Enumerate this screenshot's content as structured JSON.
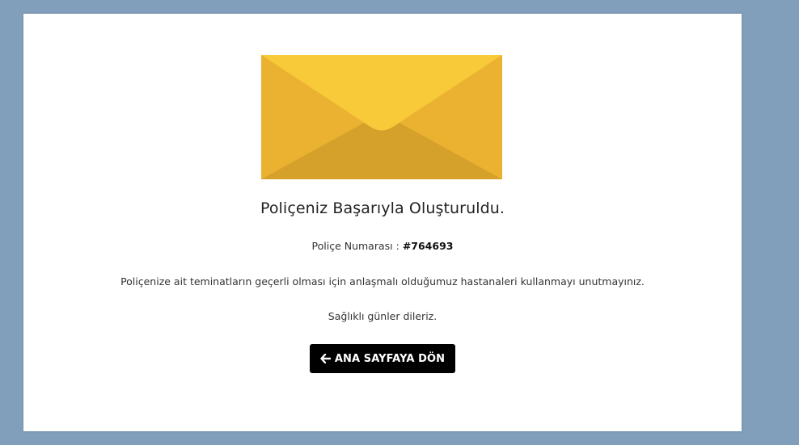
{
  "result": {
    "title": "Poliçeniz Başarıyla Oluşturuldu.",
    "policy_label": "Poliçe Numarası :",
    "policy_number": "#764693",
    "info_text": "Poliçenize ait teminatların geçerli olması için anlaşmalı olduğumuz hastanaleri kullanmayı unutmayınız.",
    "wish_text": "Sağlıklı günler dileriz.",
    "back_button_label": "ANA SAYFAYA DÖN",
    "back_icon": "arrow-left-icon",
    "illustration_icon": "envelope-icon"
  },
  "colors": {
    "page_background": "#819fba",
    "card_background": "#ffffff",
    "envelope_flap": "#f8c938",
    "envelope_side": "#eab230",
    "envelope_bottom": "#d6a12b",
    "button_background": "#000000",
    "button_text": "#ffffff"
  }
}
